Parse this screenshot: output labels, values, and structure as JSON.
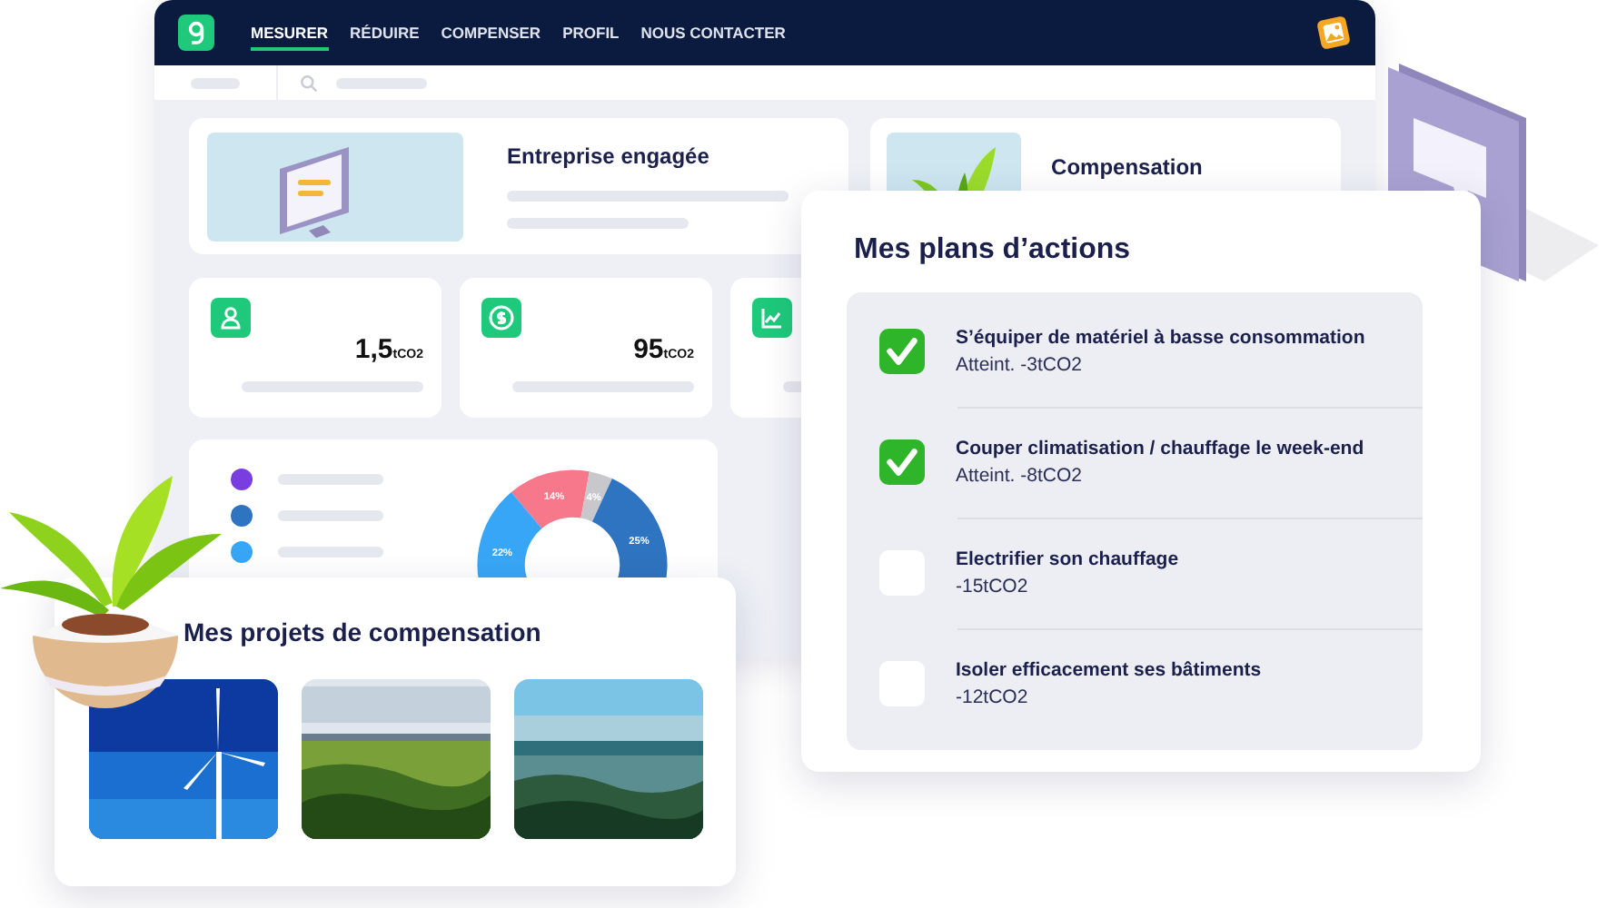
{
  "nav": {
    "items": [
      {
        "label": "MESURER",
        "selected": true
      },
      {
        "label": "RÉDUIRE",
        "selected": false
      },
      {
        "label": "COMPENSER",
        "selected": false
      },
      {
        "label": "PROFIL",
        "selected": false
      },
      {
        "label": "NOUS CONTACTER",
        "selected": false
      }
    ]
  },
  "summary_cards": [
    {
      "title": "Entreprise engagée"
    },
    {
      "title": "Compensation"
    }
  ],
  "stats": [
    {
      "kind": "user",
      "value": "1,5",
      "unit": "tCO2"
    },
    {
      "kind": "dollar",
      "value": "95",
      "unit": "tCO2"
    },
    {
      "kind": "chart"
    }
  ],
  "breakdown": {
    "legend": [
      {
        "color": "#7a3de0"
      },
      {
        "color": "#2f74c0"
      },
      {
        "color": "#38a6f6"
      }
    ],
    "chart_data": {
      "type": "donut",
      "values": [
        14,
        4,
        25,
        22
      ],
      "colors": [
        "#f7788a",
        "#c8c8cc",
        "#2f74c0",
        "#38a6f6"
      ],
      "value_labels": [
        "14%",
        "4%",
        "25%",
        "22%"
      ]
    }
  },
  "action_plans": {
    "title": "Mes plans d’actions",
    "items": [
      {
        "title": "S’équiper de matériel à basse consommation",
        "detail": "Atteint. -3tCO2",
        "checked": true
      },
      {
        "title": "Couper climatisation / chauffage le week-end",
        "detail": "Atteint. -8tCO2",
        "checked": true
      },
      {
        "title": "Electrifier son chauffage",
        "detail": "-15tCO2",
        "checked": false
      },
      {
        "title": "Isoler efficacement ses bâtiments",
        "detail": "-12tCO2",
        "checked": false
      }
    ]
  },
  "projects": {
    "title": "Mes projets de compensation"
  }
}
